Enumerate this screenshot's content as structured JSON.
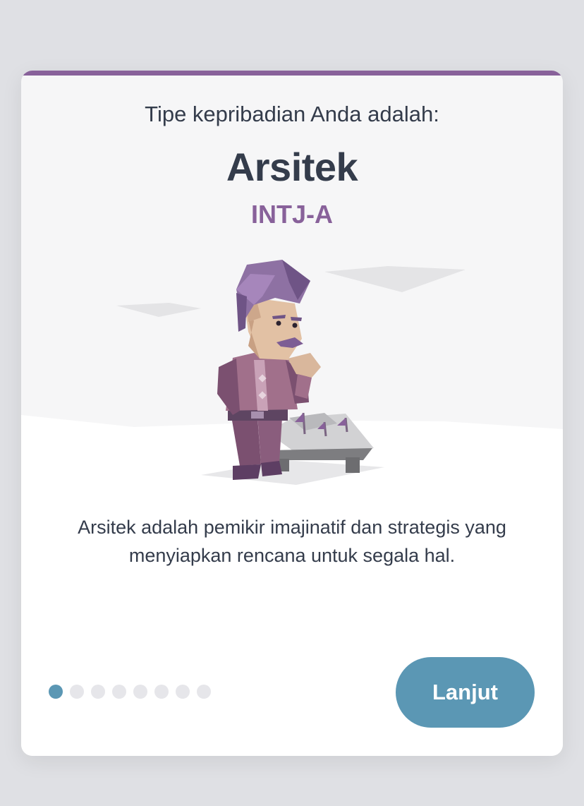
{
  "card": {
    "intro": "Tipe kepribadian Anda adalah:",
    "type_name": "Arsitek",
    "type_code": "INTJ-A",
    "illustration": "architect-character-illustration",
    "description": "Arsitek adalah pemikir imajinatif dan strategis yang menyiapkan rencana untuk segala hal.",
    "pagination": {
      "total": 8,
      "current": 1
    },
    "next_label": "Lanjut"
  },
  "colors": {
    "accent_purple": "#88619a",
    "accent_blue": "#5b97b4",
    "text_dark": "#343c4b",
    "dot_inactive": "#e6e6ea"
  }
}
